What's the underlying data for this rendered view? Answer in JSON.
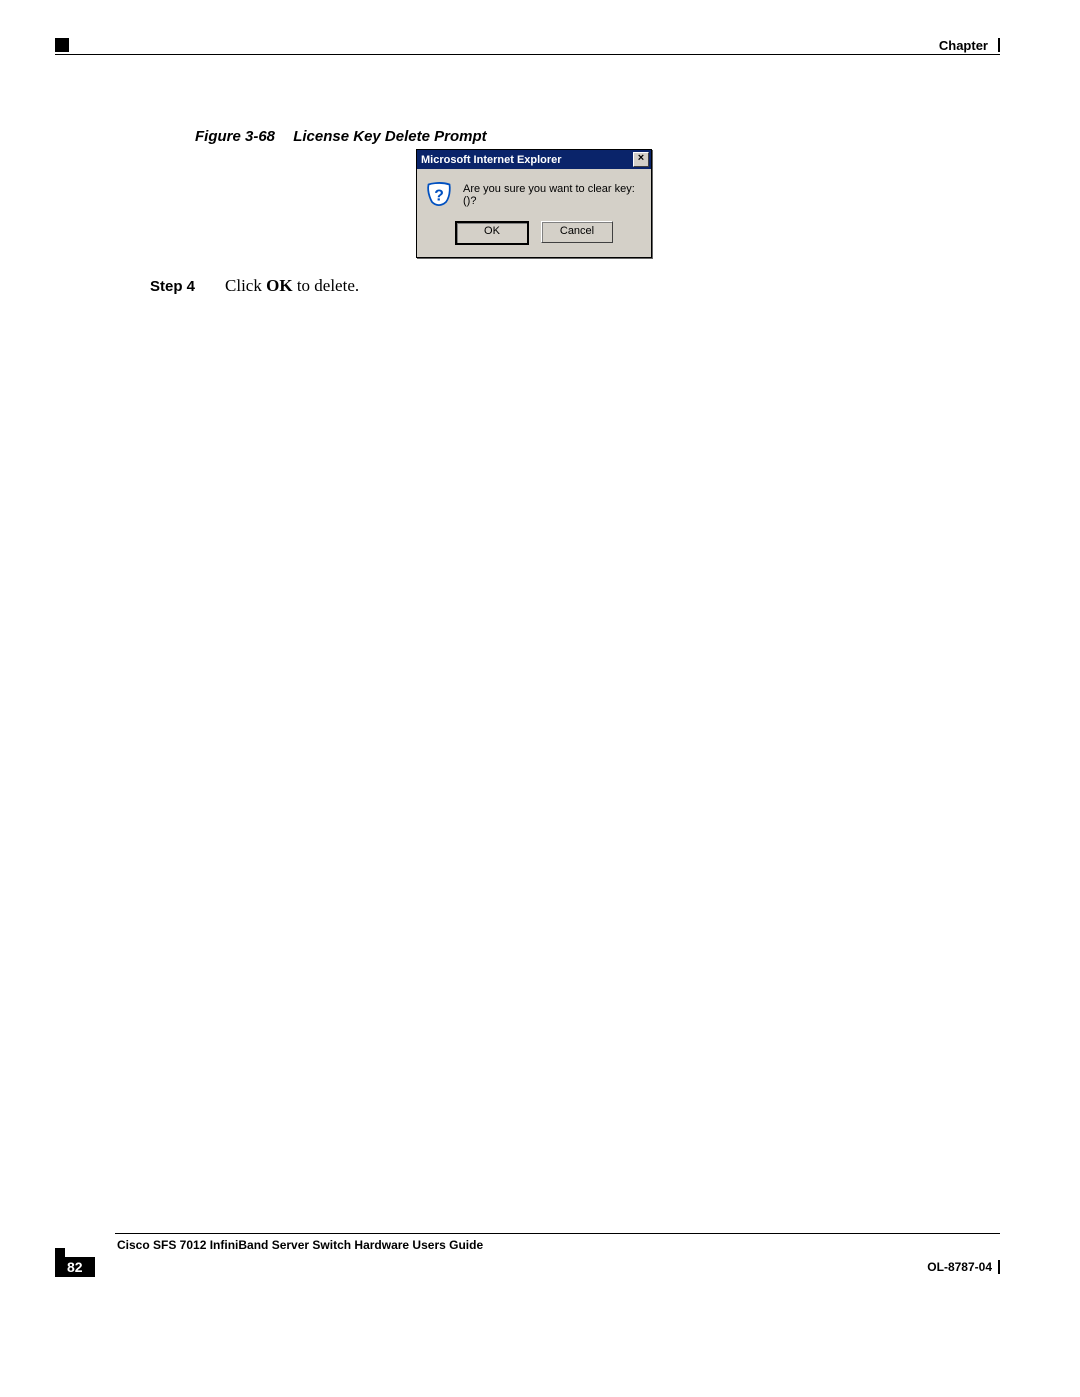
{
  "header": {
    "chapter_label": "Chapter"
  },
  "figure": {
    "number": "Figure 3-68",
    "title": "License Key Delete Prompt"
  },
  "dialog": {
    "title": "Microsoft Internet Explorer",
    "close_label": "×",
    "message": "Are you sure you want to clear key: ()?",
    "ok_label": "OK",
    "cancel_label": "Cancel"
  },
  "step": {
    "label": "Step 4",
    "text_prefix": "Click ",
    "text_bold": "OK",
    "text_suffix": " to delete."
  },
  "footer": {
    "guide_title": "Cisco SFS 7012 InfiniBand Server Switch Hardware Users Guide",
    "page_number": "82",
    "doc_id": "OL-8787-04"
  }
}
